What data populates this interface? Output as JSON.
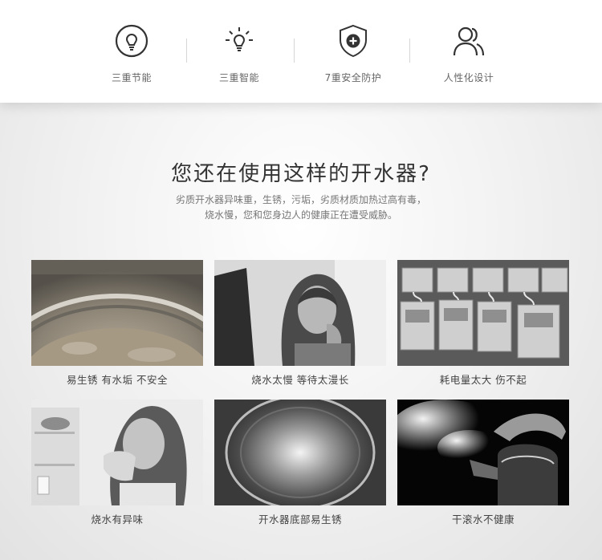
{
  "features": [
    {
      "label": "三重节能",
      "icon": "lightbulb-icon"
    },
    {
      "label": "三重智能",
      "icon": "smart-bulb-icon"
    },
    {
      "label": "7重安全防护",
      "icon": "shield-plus-icon"
    },
    {
      "label": "人性化设计",
      "icon": "users-icon"
    }
  ],
  "headline": "您还在使用这样的开水器?",
  "subtext": {
    "line1": "劣质开水器异味重，生锈，污垢，劣质材质加热过高有毒，",
    "line2": "烧水慢，您和您身边人的健康正在遭受威胁。"
  },
  "cards": [
    {
      "caption": "易生锈  有水垢  不安全",
      "image": "rusty-pot-photo"
    },
    {
      "caption": "烧水太慢  等待太漫长",
      "image": "tired-woman-photo"
    },
    {
      "caption": "耗电量太大  伤不起",
      "image": "electric-meters-photo"
    },
    {
      "caption": "烧水有异味",
      "image": "woman-covering-nose-photo"
    },
    {
      "caption": "开水器底部易生锈",
      "image": "boiler-bottom-photo"
    },
    {
      "caption": "干滚水不健康",
      "image": "steaming-kettle-photo"
    }
  ]
}
